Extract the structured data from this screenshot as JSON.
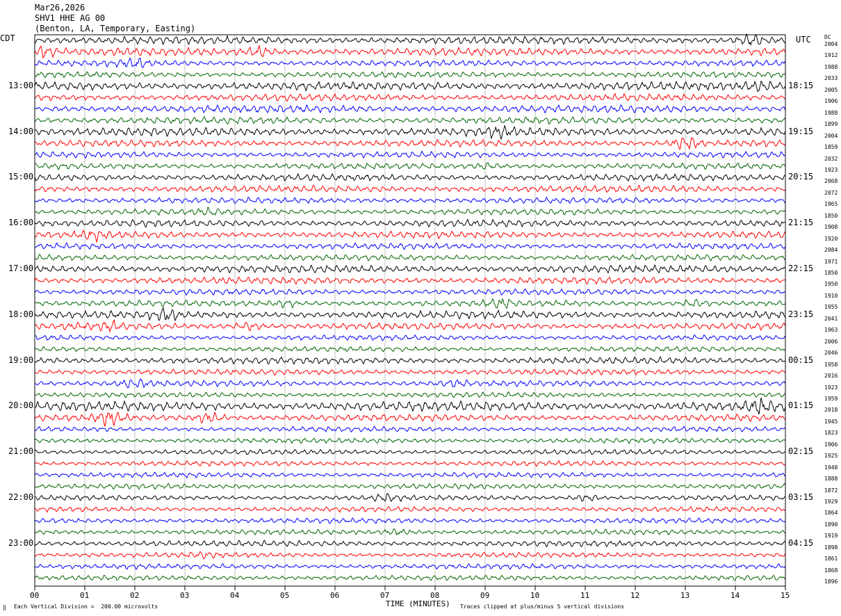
{
  "header": {
    "date": "Mar26,2026",
    "station": "SHV1 HHE AG 00",
    "location": "(Benton, LA, Temporary, Easting)"
  },
  "left_tz": "CDT",
  "right_tz": "UTC",
  "dc_label": "DC",
  "footer": {
    "scale_note": "Each Vertical Division =  200.00 microvolts",
    "clip_note": "Traces clipped at plus/minus 5 vertical divisions",
    "corner_mark": "‖"
  },
  "colors": {
    "cycle": [
      "#000000",
      "#ff0000",
      "#0000ff",
      "#006400"
    ]
  },
  "chart_data": {
    "type": "line",
    "xlabel": "TIME (MINUTES)",
    "xlim": [
      0,
      15
    ],
    "x_ticks": [
      "00",
      "01",
      "02",
      "03",
      "04",
      "05",
      "06",
      "07",
      "08",
      "09",
      "10",
      "11",
      "12",
      "13",
      "14",
      "15"
    ],
    "left_hour_labels": [
      {
        "label": "13:00",
        "trace": 4
      },
      {
        "label": "14:00",
        "trace": 8
      },
      {
        "label": "15:00",
        "trace": 12
      },
      {
        "label": "16:00",
        "trace": 16
      },
      {
        "label": "17:00",
        "trace": 20
      },
      {
        "label": "18:00",
        "trace": 24
      },
      {
        "label": "19:00",
        "trace": 28
      },
      {
        "label": "20:00",
        "trace": 32
      },
      {
        "label": "21:00",
        "trace": 36
      },
      {
        "label": "22:00",
        "trace": 40
      },
      {
        "label": "23:00",
        "trace": 44
      }
    ],
    "right_hour_labels": [
      {
        "label": "18:15",
        "trace": 4
      },
      {
        "label": "19:15",
        "trace": 8
      },
      {
        "label": "20:15",
        "trace": 12
      },
      {
        "label": "21:15",
        "trace": 16
      },
      {
        "label": "22:15",
        "trace": 20
      },
      {
        "label": "23:15",
        "trace": 24
      },
      {
        "label": "00:15",
        "trace": 28
      },
      {
        "label": "01:15",
        "trace": 32
      },
      {
        "label": "02:15",
        "trace": 36
      },
      {
        "label": "03:15",
        "trace": 40
      },
      {
        "label": "04:15",
        "trace": 44
      }
    ],
    "trace_offsets": [
      "2004",
      "1912",
      "1988",
      "2033",
      "2005",
      "1906",
      "1988",
      "1899",
      "2004",
      "1859",
      "2032",
      "1923",
      "2068",
      "2072",
      "1965",
      "1850",
      "1908",
      "1920",
      "2084",
      "1971",
      "1850",
      "1950",
      "1910",
      "1955",
      "2041",
      "1963",
      "2006",
      "2046",
      "1958",
      "2016",
      "1923",
      "1959",
      "2018",
      "1945",
      "1823",
      "1906",
      "1925",
      "1948",
      "1888",
      "1872",
      "1929",
      "1864",
      "1890",
      "1919",
      "1898",
      "1861",
      "1868",
      "1896"
    ],
    "series": [
      {
        "trace": 0,
        "amplitude": 0.9,
        "bursts": [
          {
            "minute": 14.3,
            "strength": 1.5
          }
        ]
      },
      {
        "trace": 1,
        "amplitude": 0.9,
        "bursts": [
          {
            "minute": 0.2,
            "strength": 1.2
          },
          {
            "minute": 4.5,
            "strength": 1.0
          }
        ]
      },
      {
        "trace": 2,
        "amplitude": 0.7,
        "bursts": [
          {
            "minute": 2.0,
            "strength": 1.8
          }
        ]
      },
      {
        "trace": 3,
        "amplitude": 0.7,
        "bursts": []
      },
      {
        "trace": 4,
        "amplitude": 1.0,
        "bursts": [
          {
            "minute": 14.5,
            "strength": 0.8
          }
        ]
      },
      {
        "trace": 5,
        "amplitude": 0.8,
        "bursts": []
      },
      {
        "trace": 6,
        "amplitude": 0.9,
        "bursts": []
      },
      {
        "trace": 7,
        "amplitude": 0.8,
        "bursts": []
      },
      {
        "trace": 8,
        "amplitude": 1.0,
        "bursts": [
          {
            "minute": 9.3,
            "strength": 0.8
          }
        ]
      },
      {
        "trace": 9,
        "amplitude": 0.8,
        "bursts": [
          {
            "minute": 13.0,
            "strength": 1.8
          }
        ]
      },
      {
        "trace": 10,
        "amplitude": 0.7,
        "bursts": []
      },
      {
        "trace": 11,
        "amplitude": 0.7,
        "bursts": [
          {
            "minute": 9.0,
            "strength": 0.8
          }
        ]
      },
      {
        "trace": 12,
        "amplitude": 0.8,
        "bursts": []
      },
      {
        "trace": 13,
        "amplitude": 0.8,
        "bursts": []
      },
      {
        "trace": 14,
        "amplitude": 0.7,
        "bursts": []
      },
      {
        "trace": 15,
        "amplitude": 0.7,
        "bursts": [
          {
            "minute": 3.5,
            "strength": 0.7
          }
        ]
      },
      {
        "trace": 16,
        "amplitude": 0.8,
        "bursts": []
      },
      {
        "trace": 17,
        "amplitude": 0.8,
        "bursts": [
          {
            "minute": 1.2,
            "strength": 1.0
          }
        ]
      },
      {
        "trace": 18,
        "amplitude": 0.7,
        "bursts": []
      },
      {
        "trace": 19,
        "amplitude": 0.7,
        "bursts": []
      },
      {
        "trace": 20,
        "amplitude": 0.9,
        "bursts": []
      },
      {
        "trace": 21,
        "amplitude": 0.8,
        "bursts": []
      },
      {
        "trace": 22,
        "amplitude": 0.7,
        "bursts": []
      },
      {
        "trace": 23,
        "amplitude": 0.7,
        "bursts": [
          {
            "minute": 5.0,
            "strength": 1.0
          },
          {
            "minute": 9.3,
            "strength": 1.2
          },
          {
            "minute": 13.2,
            "strength": 1.2
          }
        ]
      },
      {
        "trace": 24,
        "amplitude": 0.9,
        "bursts": [
          {
            "minute": 2.6,
            "strength": 1.3
          }
        ]
      },
      {
        "trace": 25,
        "amplitude": 0.8,
        "bursts": [
          {
            "minute": 1.5,
            "strength": 1.0
          },
          {
            "minute": 4.3,
            "strength": 1.0
          }
        ]
      },
      {
        "trace": 26,
        "amplitude": 0.6,
        "bursts": []
      },
      {
        "trace": 27,
        "amplitude": 0.6,
        "bursts": []
      },
      {
        "trace": 28,
        "amplitude": 0.8,
        "bursts": []
      },
      {
        "trace": 29,
        "amplitude": 0.7,
        "bursts": []
      },
      {
        "trace": 30,
        "amplitude": 0.7,
        "bursts": [
          {
            "minute": 2.0,
            "strength": 1.4
          },
          {
            "minute": 8.4,
            "strength": 1.0
          }
        ]
      },
      {
        "trace": 31,
        "amplitude": 0.6,
        "bursts": []
      },
      {
        "trace": 32,
        "amplitude": 1.1,
        "bursts": [
          {
            "minute": 14.5,
            "strength": 1.2
          }
        ]
      },
      {
        "trace": 33,
        "amplitude": 0.8,
        "bursts": [
          {
            "minute": 1.5,
            "strength": 2.0
          },
          {
            "minute": 3.5,
            "strength": 1.5
          }
        ]
      },
      {
        "trace": 34,
        "amplitude": 0.6,
        "bursts": []
      },
      {
        "trace": 35,
        "amplitude": 0.6,
        "bursts": []
      },
      {
        "trace": 36,
        "amplitude": 0.6,
        "bursts": []
      },
      {
        "trace": 37,
        "amplitude": 0.6,
        "bursts": []
      },
      {
        "trace": 38,
        "amplitude": 0.6,
        "bursts": []
      },
      {
        "trace": 39,
        "amplitude": 0.6,
        "bursts": []
      },
      {
        "trace": 40,
        "amplitude": 0.6,
        "bursts": [
          {
            "minute": 7.0,
            "strength": 1.2
          },
          {
            "minute": 11.0,
            "strength": 1.2
          }
        ]
      },
      {
        "trace": 41,
        "amplitude": 0.6,
        "bursts": []
      },
      {
        "trace": 42,
        "amplitude": 0.6,
        "bursts": []
      },
      {
        "trace": 43,
        "amplitude": 0.6,
        "bursts": [
          {
            "minute": 7.2,
            "strength": 1.0
          }
        ]
      },
      {
        "trace": 44,
        "amplitude": 0.7,
        "bursts": []
      },
      {
        "trace": 45,
        "amplitude": 0.6,
        "bursts": [
          {
            "minute": 3.4,
            "strength": 0.8
          }
        ]
      },
      {
        "trace": 46,
        "amplitude": 0.6,
        "bursts": []
      },
      {
        "trace": 47,
        "amplitude": 0.6,
        "bursts": []
      }
    ]
  }
}
